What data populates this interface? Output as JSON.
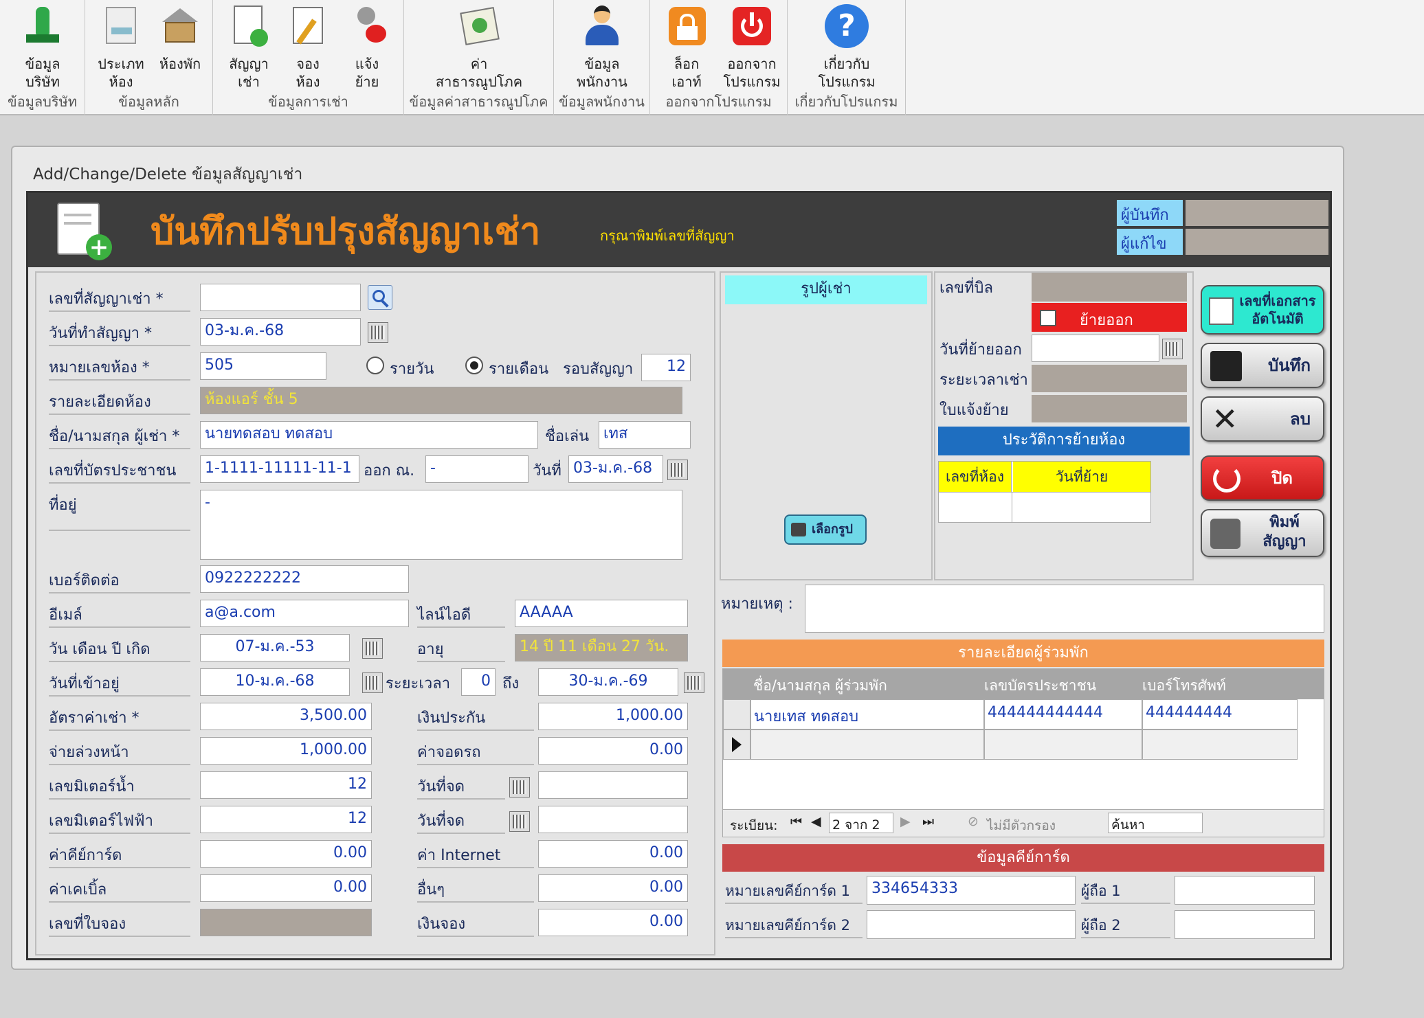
{
  "ribbon": {
    "groups": [
      {
        "caption": "ข้อมูลบริษัท",
        "buttons": [
          {
            "label": "ข้อมูล\nบริษัท",
            "icon": "company-icon"
          }
        ]
      },
      {
        "caption": "ข้อมูลหลัก",
        "buttons": [
          {
            "label": "ประเภท\nห้อง",
            "icon": "room-type-icon"
          },
          {
            "label": "ห้องพัก",
            "icon": "room-icon"
          }
        ]
      },
      {
        "caption": "ข้อมูลการเช่า",
        "buttons": [
          {
            "label": "สัญญา\nเช่า",
            "icon": "contract-icon"
          },
          {
            "label": "จอง\nห้อง",
            "icon": "booking-icon"
          },
          {
            "label": "แจ้ง\nย้าย",
            "icon": "move-icon"
          }
        ]
      },
      {
        "caption": "ข้อมูลค่าสาธารณูปโภค",
        "buttons": [
          {
            "label": "ค่า\nสาธารณูปโภค",
            "icon": "utility-bill-icon"
          }
        ]
      },
      {
        "caption": "ข้อมูลพนักงาน",
        "buttons": [
          {
            "label": "ข้อมูล\nพนักงาน",
            "icon": "employee-icon"
          }
        ]
      },
      {
        "caption": "ออกจากโปรแกรม",
        "buttons": [
          {
            "label": "ล็อก\nเอาท์",
            "icon": "lock-icon"
          },
          {
            "label": "ออกจาก\nโปรแกรม",
            "icon": "power-icon"
          }
        ]
      },
      {
        "caption": "เกี่ยวกับโปรแกรม",
        "buttons": [
          {
            "label": "เกี่ยวกับ\nโปรแกรม",
            "icon": "help-icon"
          }
        ]
      }
    ]
  },
  "window": {
    "title": "Add/Change/Delete ข้อมูลสัญญาเช่า"
  },
  "header": {
    "title": "บันทึกปรับปรุงสัญญาเช่า",
    "hint": "กรุณาพิมพ์เลขที่สัญญา",
    "recorder_label": "ผู้บันทึก",
    "editor_label": "ผู้แก้ไข",
    "recorder_value": "",
    "editor_value": ""
  },
  "form": {
    "contract_no": {
      "label": "เลขที่สัญญาเช่า *",
      "value": ""
    },
    "contract_date": {
      "label": "วันที่ทำสัญญา *",
      "value": "03-ม.ค.-68"
    },
    "room_no": {
      "label": "หมายเลขห้อง *",
      "value": "505"
    },
    "rent_type": {
      "daily": "รายวัน",
      "monthly": "รายเดือน",
      "selected": "monthly"
    },
    "contract_cycle": {
      "label": "รอบสัญญา",
      "value": "12"
    },
    "room_detail": {
      "label": "รายละเอียดห้อง",
      "value": "ห้องแอร์ ชั้น 5"
    },
    "tenant_name": {
      "label": "ชื่อ/นามสกุล ผู้เช่า *",
      "value": "นายทดสอบ ทดสอบ"
    },
    "nickname": {
      "label": "ชื่อเล่น",
      "value": "เทส"
    },
    "id_card": {
      "label": "เลขที่บัตรประชาชน",
      "value": "1-1111-11111-11-1"
    },
    "issued_at": {
      "label": "ออก ณ.",
      "value": "-"
    },
    "issue_date": {
      "label": "วันที่",
      "value": "03-ม.ค.-68"
    },
    "address": {
      "label": "ที่อยู่",
      "value": "-"
    },
    "phone": {
      "label": "เบอร์ติดต่อ",
      "value": "0922222222"
    },
    "email": {
      "label": "อีเมล์",
      "value": "a@a.com"
    },
    "line_id": {
      "label": "ไลน์ไอดี",
      "value": "AAAAA"
    },
    "birth_date": {
      "label": "วัน เดือน ปี เกิด",
      "value": "07-ม.ค.-53"
    },
    "age": {
      "label": "อายุ",
      "value": "14 ปี 11 เดือน 27 วัน."
    },
    "move_in_date": {
      "label": "วันที่เข้าอยู่",
      "value": "10-ม.ค.-68"
    },
    "duration": {
      "label": "ระยะเวลา",
      "value": "0",
      "to_label": "ถึง",
      "end_date": "30-ม.ค.-69"
    },
    "rent_rate": {
      "label": "อัตราค่าเช่า *",
      "value": "3,500.00"
    },
    "deposit": {
      "label": "เงินประกัน",
      "value": "1,000.00"
    },
    "advance": {
      "label": "จ่ายล่วงหน้า",
      "value": "1,000.00"
    },
    "parking": {
      "label": "ค่าจอดรถ",
      "value": "0.00"
    },
    "water_meter": {
      "label": "เลขมิเตอร์น้ำ",
      "value": "12"
    },
    "water_date": {
      "label": "วันที่จด",
      "value": ""
    },
    "electric_meter": {
      "label": "เลขมิเตอร์ไฟฟ้า",
      "value": "12"
    },
    "electric_date": {
      "label": "วันที่จด",
      "value": ""
    },
    "keycard_fee": {
      "label": "ค่าคีย์การ์ด",
      "value": "0.00"
    },
    "internet_fee": {
      "label": "ค่า Internet",
      "value": "0.00"
    },
    "cable_fee": {
      "label": "ค่าเคเบิ้ล",
      "value": "0.00"
    },
    "other_fee": {
      "label": "อื่นๆ",
      "value": "0.00"
    },
    "booking_no": {
      "label": "เลขที่ใบจอง",
      "value": ""
    },
    "booking_money": {
      "label": "เงินจอง",
      "value": "0.00"
    }
  },
  "photo": {
    "title": "รูปผู้เช่า",
    "choose_button": "เลือกรูป"
  },
  "moveout": {
    "bill_no_label": "เลขที่บิล",
    "moveout_checkbox": "ย้ายออก",
    "moveout_date_label": "วันที่ย้ายออก",
    "rent_period_label": "ระยะเวลาเช่า",
    "notice_label": "ใบแจ้งย้าย",
    "history_title": "ประวัติการย้ายห้อง",
    "history_cols": [
      "เลขที่ห้อง",
      "วันที่ย้าย"
    ]
  },
  "buttons": {
    "auto_doc": "เลขที่เอกสารอัตโนมัติ",
    "save": "บันทึก",
    "delete": "ลบ",
    "close": "ปิด",
    "print": "พิมพ์สัญญา"
  },
  "note": {
    "label": "หมายเหตุ :",
    "value": ""
  },
  "cotenants": {
    "title": "รายละเอียดผู้ร่วมพัก",
    "columns": [
      "ชื่อ/นามสกุล ผู้ร่วมพัก",
      "เลขบัตรประชาชน",
      "เบอร์โทรศัพท์"
    ],
    "rows": [
      [
        "นายเทส ทดสอบ",
        "444444444444",
        "444444444"
      ]
    ],
    "nav": {
      "record_label": "ระเบียน:",
      "position": "2 จาก 2",
      "filter": "ไม่มีตัวกรอง",
      "search": "ค้นหา"
    }
  },
  "keycard": {
    "title": "ข้อมูลคีย์การ์ด",
    "card1_label": "หมายเลขคีย์การ์ด 1",
    "card1_value": "334654333",
    "holder1_label": "ผู้ถือ 1",
    "holder1_value": "",
    "card2_label": "หมายเลขคีย์การ์ด 2",
    "card2_value": "",
    "holder2_label": "ผู้ถือ 2",
    "holder2_value": ""
  },
  "colors": {
    "accent_orange": "#f08a1c",
    "header_bg": "#3d3d3d",
    "photo_bar": "#8cf8f8",
    "history_bar": "#1e6ec0",
    "cotenant_bar": "#f49a52",
    "keycard_bar": "#c84848",
    "moveout_red": "#e82020"
  }
}
